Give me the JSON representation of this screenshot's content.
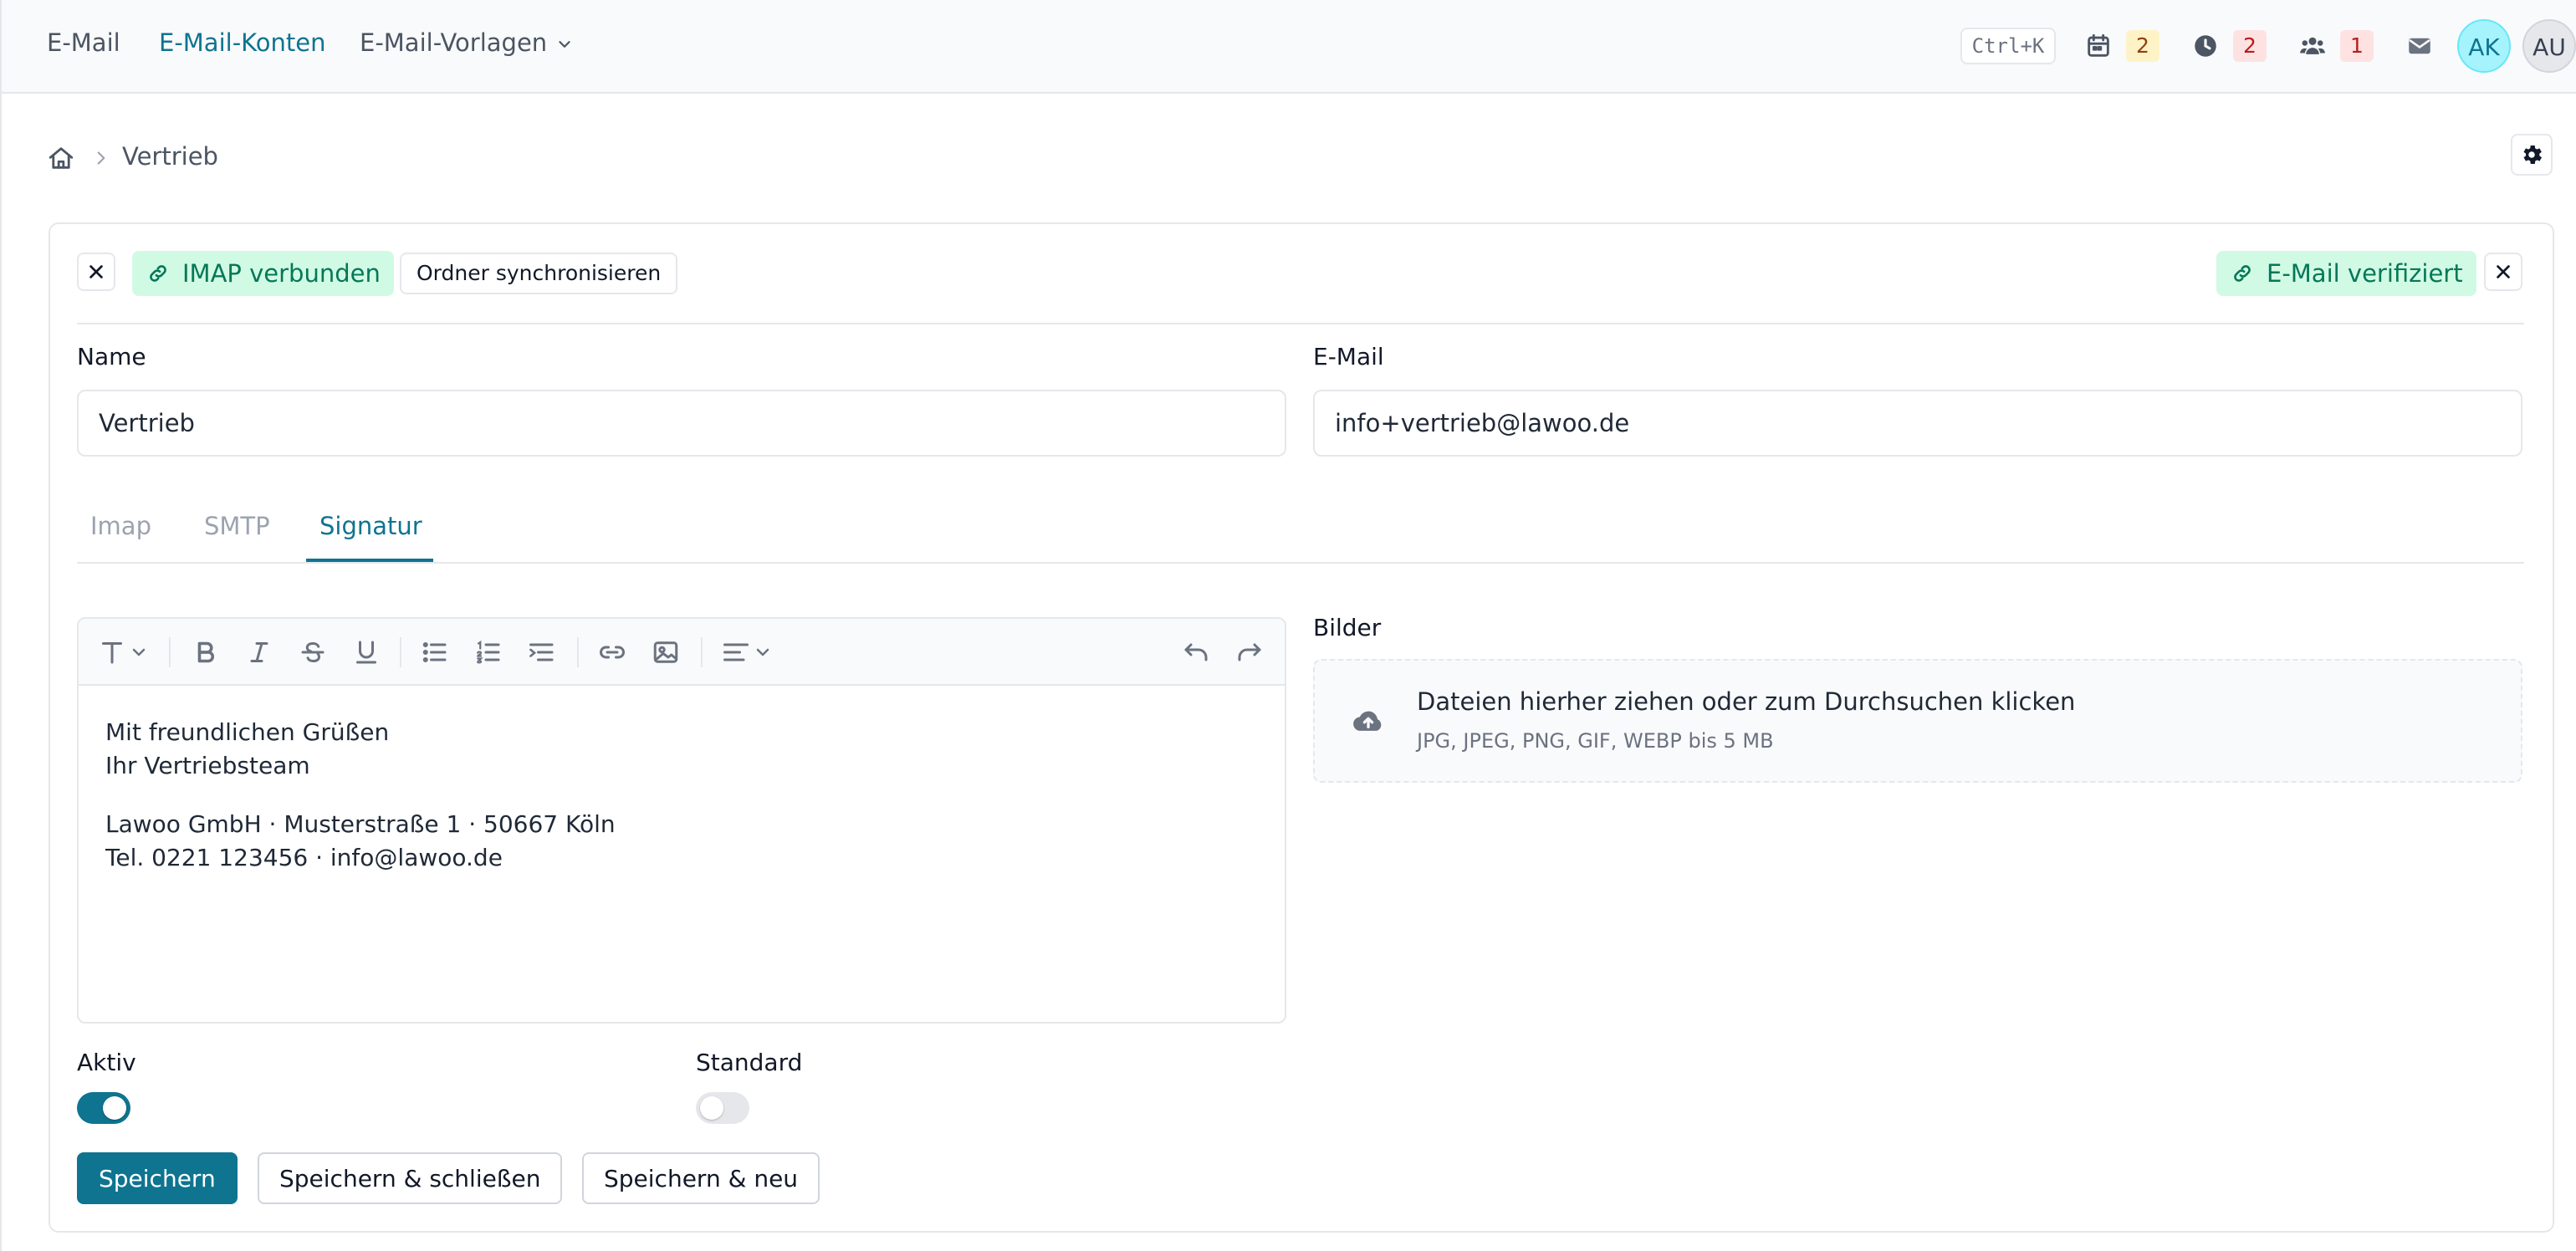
{
  "nav": {
    "items": [
      {
        "label": "E-Mail",
        "active": false
      },
      {
        "label": "E-Mail-Konten",
        "active": true
      },
      {
        "label": "E-Mail-Vorlagen",
        "active": false,
        "has_dropdown": true
      }
    ]
  },
  "header": {
    "shortcut": "Ctrl+K",
    "indicators": [
      {
        "icon": "calendar-icon",
        "count": "2",
        "color": "#fef3c7"
      },
      {
        "icon": "clock-icon",
        "count": "2",
        "color": "#fee2e2"
      },
      {
        "icon": "users-icon",
        "count": "1",
        "color": "#fee2e2"
      }
    ],
    "mail_icon": "envelope-icon",
    "avatars": [
      {
        "initials": "AK"
      },
      {
        "initials": "AU"
      }
    ]
  },
  "breadcrumb": {
    "home_icon": "home-icon",
    "current": "Vertrieb"
  },
  "status": {
    "imap": "IMAP verbunden",
    "sync_button": "Ordner synchronisieren",
    "email_verified": "E-Mail verifiziert"
  },
  "form": {
    "name_label": "Name",
    "name_value": "Vertrieb",
    "email_label": "E-Mail",
    "email_value": "info+vertrieb@lawoo.de"
  },
  "tabs": [
    {
      "label": "Imap",
      "active": false
    },
    {
      "label": "SMTP",
      "active": false
    },
    {
      "label": "Signatur",
      "active": true
    }
  ],
  "signature": {
    "lines": [
      "Mit freundlichen Grüßen",
      "Ihr Vertriebsteam",
      "Lawoo GmbH · Musterstraße 1 · 50667 Köln",
      "Tel. 0221 123456 · info@lawoo.de"
    ]
  },
  "images": {
    "label": "Bilder",
    "dropzone_title": "Dateien hierher ziehen oder zum Durchsuchen klicken",
    "dropzone_hint": "JPG, JPEG, PNG, GIF, WEBP bis 5 MB"
  },
  "toggles": {
    "active_label": "Aktiv",
    "active_on": true,
    "default_label": "Standard",
    "default_on": false
  },
  "actions": {
    "save": "Speichern",
    "save_close": "Speichern & schließen",
    "save_new": "Speichern & neu"
  },
  "colors": {
    "accent": "#0e7490",
    "success_bg": "#d1fae5",
    "success_text": "#047857"
  }
}
